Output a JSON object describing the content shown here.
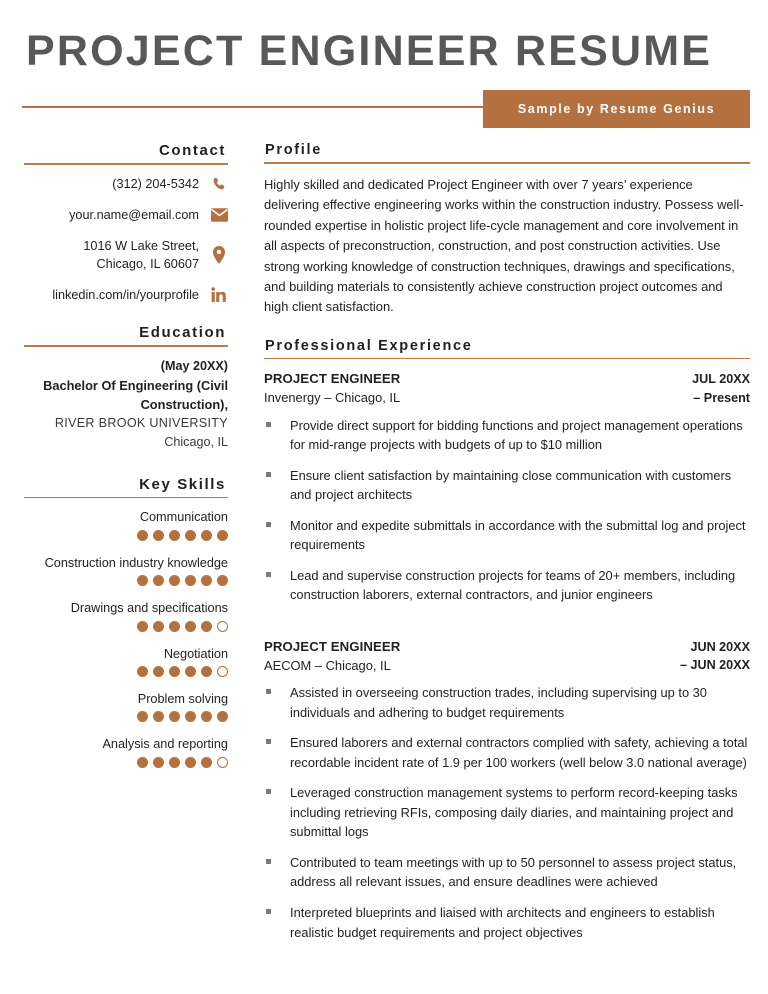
{
  "header": {
    "title": "PROJECT ENGINEER RESUME",
    "badge_label": "Sample by Resume Genius"
  },
  "colors": {
    "accent": "#b4703f",
    "rule": "#c07a4b",
    "title": "#58585a",
    "text": "#231f20",
    "bullet": "#7b7b7b"
  },
  "sidebar": {
    "contact": {
      "heading": "Contact",
      "items": [
        {
          "icon": "phone-icon",
          "text": "(312) 204-5342"
        },
        {
          "icon": "envelope-icon",
          "text": "your.name@email.com"
        },
        {
          "icon": "map-pin-icon",
          "line1": "1016 W Lake Street,",
          "line2": "Chicago, IL 60607"
        },
        {
          "icon": "linkedin-icon",
          "text": "linkedin.com/in/yourprofile"
        }
      ]
    },
    "education": {
      "heading": "Education",
      "date": "(May 20XX)",
      "degree_line1": "Bachelor Of Engineering (Civil",
      "degree_line2": "Construction),",
      "school": "RIVER BROOK UNIVERSITY",
      "location": "Chicago, IL"
    },
    "skills": {
      "heading": "Key Skills",
      "max_rating": 6,
      "items": [
        {
          "name": "Communication",
          "rating": 6
        },
        {
          "name": "Construction industry knowledge",
          "rating": 6
        },
        {
          "name": "Drawings and specifications",
          "rating": 5
        },
        {
          "name": "Negotiation",
          "rating": 5
        },
        {
          "name": "Problem solving",
          "rating": 6
        },
        {
          "name": "Analysis and reporting",
          "rating": 5
        }
      ]
    }
  },
  "main": {
    "profile": {
      "heading": "Profile",
      "text": "Highly skilled and dedicated Project Engineer with over 7 years’ experience delivering effective engineering works within the construction industry. Possess well-rounded expertise in holistic project life-cycle management and core involvement in all aspects of preconstruction, construction, and post construction activities. Use strong working knowledge of construction techniques, drawings and specifications, and building materials to consistently achieve construction project outcomes and high client satisfaction."
    },
    "experience": {
      "heading": "Professional Experience",
      "jobs": [
        {
          "title": "PROJECT ENGINEER",
          "company": "Invenergy – Chicago, IL",
          "date_line1": "JUL 20XX",
          "date_line2": "– Present",
          "bullets": [
            "Provide direct support for bidding functions and project management operations for mid-range projects with budgets of up to $10 million",
            "Ensure client satisfaction by maintaining close communication with customers and project architects",
            "Monitor and expedite submittals in accordance with the submittal log and project requirements",
            "Lead and supervise construction projects for teams of 20+ members, including construction laborers, external contractors, and junior engineers"
          ]
        },
        {
          "title": "PROJECT ENGINEER",
          "company": "AECOM – Chicago, IL",
          "date_line1": "JUN 20XX",
          "date_line2": "– JUN 20XX",
          "bullets": [
            "Assisted in overseeing construction trades, including supervising up to 30 individuals and adhering to budget requirements",
            "Ensured laborers and external contractors complied with safety, achieving a total recordable incident rate of 1.9 per 100 workers (well below 3.0 national average)",
            "Leveraged construction management systems to perform record-keeping tasks including retrieving RFIs, composing daily diaries, and maintaining project and submittal logs",
            "Contributed to team meetings with up to 50 personnel to assess project status, address all relevant issues, and ensure deadlines were achieved",
            "Interpreted blueprints and liaised with architects and engineers to establish realistic budget requirements and project objectives"
          ]
        }
      ]
    }
  }
}
